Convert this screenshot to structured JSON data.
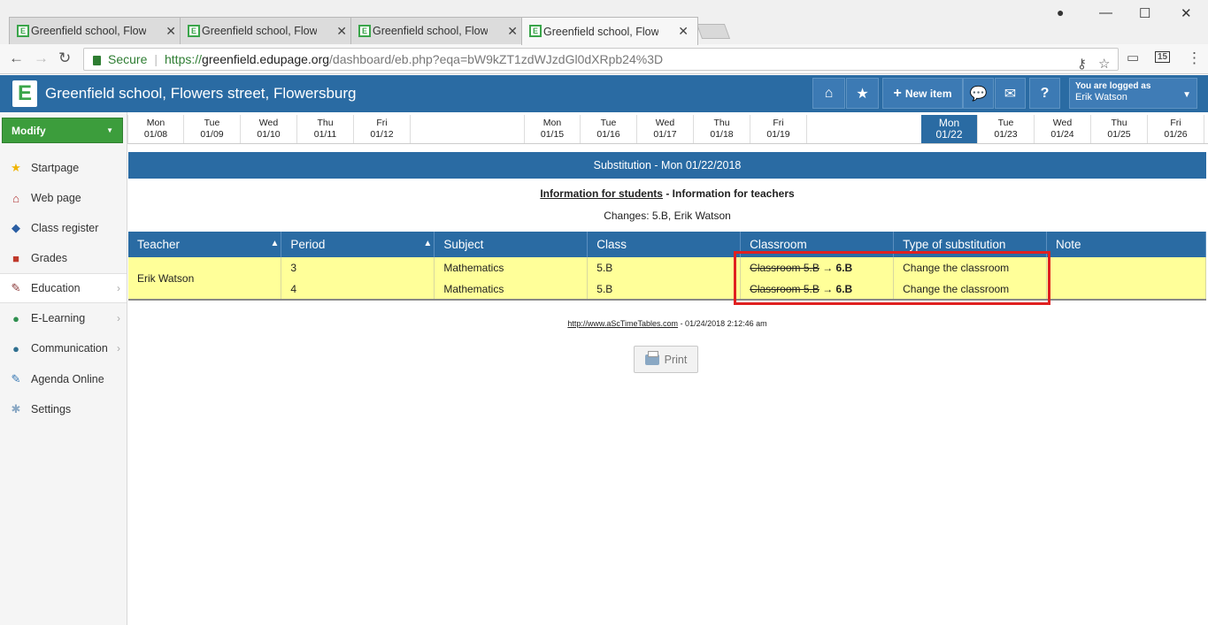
{
  "browser": {
    "tabs": [
      {
        "title": "Greenfield school, Flowers street",
        "active": false
      },
      {
        "title": "Greenfield school, Flowers street",
        "active": false
      },
      {
        "title": "Greenfield school, Flowers street",
        "active": false
      },
      {
        "title": "Greenfield school, Flowers street",
        "active": true
      }
    ],
    "tab_favicon_letter": "E",
    "tab_close": "✕",
    "window": {
      "minimize": "—",
      "maximize": "☐",
      "close": "✕"
    },
    "address": {
      "secure_label": "Secure",
      "url_scheme": "https://",
      "url_host": "greenfield.edupage.org",
      "url_path": "/dashboard/eb.php?eqa=bW9kZT1zdWJzdGl0dXRpb24%3D"
    },
    "extension_badge": "15"
  },
  "header": {
    "logo_letter": "E",
    "school_name": "Greenfield school, Flowers street, Flowersburg",
    "new_item_label": "New item",
    "help_label": "?",
    "logged_in_label": "You are logged as",
    "user_name": "Erik Watson"
  },
  "sidebar": {
    "modify_label": "Modify",
    "items": [
      {
        "label": "Startpage",
        "icon": "star-icon",
        "has_arrow": false
      },
      {
        "label": "Web page",
        "icon": "house-icon",
        "has_arrow": false
      },
      {
        "label": "Class register",
        "icon": "book-icon",
        "has_arrow": false
      },
      {
        "label": "Grades",
        "icon": "grades-icon",
        "has_arrow": false
      },
      {
        "label": "Education",
        "icon": "education-icon",
        "has_arrow": true
      },
      {
        "label": "E-Learning",
        "icon": "globe-icon",
        "has_arrow": true
      },
      {
        "label": "Communication",
        "icon": "communication-icon",
        "has_arrow": true
      },
      {
        "label": "Agenda Online",
        "icon": "pen-icon",
        "has_arrow": false
      },
      {
        "label": "Settings",
        "icon": "gear-icon",
        "has_arrow": false
      }
    ]
  },
  "days": [
    {
      "dow": "Mon",
      "date": "01/08"
    },
    {
      "dow": "Tue",
      "date": "01/09"
    },
    {
      "dow": "Wed",
      "date": "01/10"
    },
    {
      "dow": "Thu",
      "date": "01/11"
    },
    {
      "dow": "Fri",
      "date": "01/12"
    },
    {
      "dow": "Mon",
      "date": "01/15"
    },
    {
      "dow": "Tue",
      "date": "01/16"
    },
    {
      "dow": "Wed",
      "date": "01/17"
    },
    {
      "dow": "Thu",
      "date": "01/18"
    },
    {
      "dow": "Fri",
      "date": "01/19"
    },
    {
      "dow": "Mon",
      "date": "01/22",
      "selected": true
    },
    {
      "dow": "Tue",
      "date": "01/23"
    },
    {
      "dow": "Wed",
      "date": "01/24"
    },
    {
      "dow": "Thu",
      "date": "01/25"
    },
    {
      "dow": "Fri",
      "date": "01/26"
    }
  ],
  "main": {
    "title": "Substitution - Mon 01/22/2018",
    "info_students": "Information for students",
    "info_sep": " - ",
    "info_teachers": "Information for teachers",
    "changes": "Changes: 5.B, Erik Watson",
    "table": {
      "headers": [
        "Teacher",
        "Period",
        "Subject",
        "Class",
        "Classroom",
        "Type of substitution",
        "Note"
      ],
      "teacher": "Erik Watson",
      "rows": [
        {
          "period": "3",
          "subject": "Mathematics",
          "class": "5.B",
          "old_room": "Classroom 5.B",
          "arrow": " → ",
          "new_room": "6.B",
          "type": "Change the classroom",
          "note": ""
        },
        {
          "period": "4",
          "subject": "Mathematics",
          "class": "5.B",
          "old_room": "Classroom 5.B",
          "arrow": " → ",
          "new_room": "6.B",
          "type": "Change the classroom",
          "note": ""
        }
      ]
    },
    "footer_link": "http://www.aScTimeTables.com",
    "footer_text": " - 01/24/2018 2:12:46 am",
    "print_label": "Print"
  },
  "colors": {
    "brand_blue": "#2a6ba3",
    "modify_green": "#3c9d3c",
    "row_highlight": "#ffff99",
    "annotation_red": "#e02020"
  }
}
